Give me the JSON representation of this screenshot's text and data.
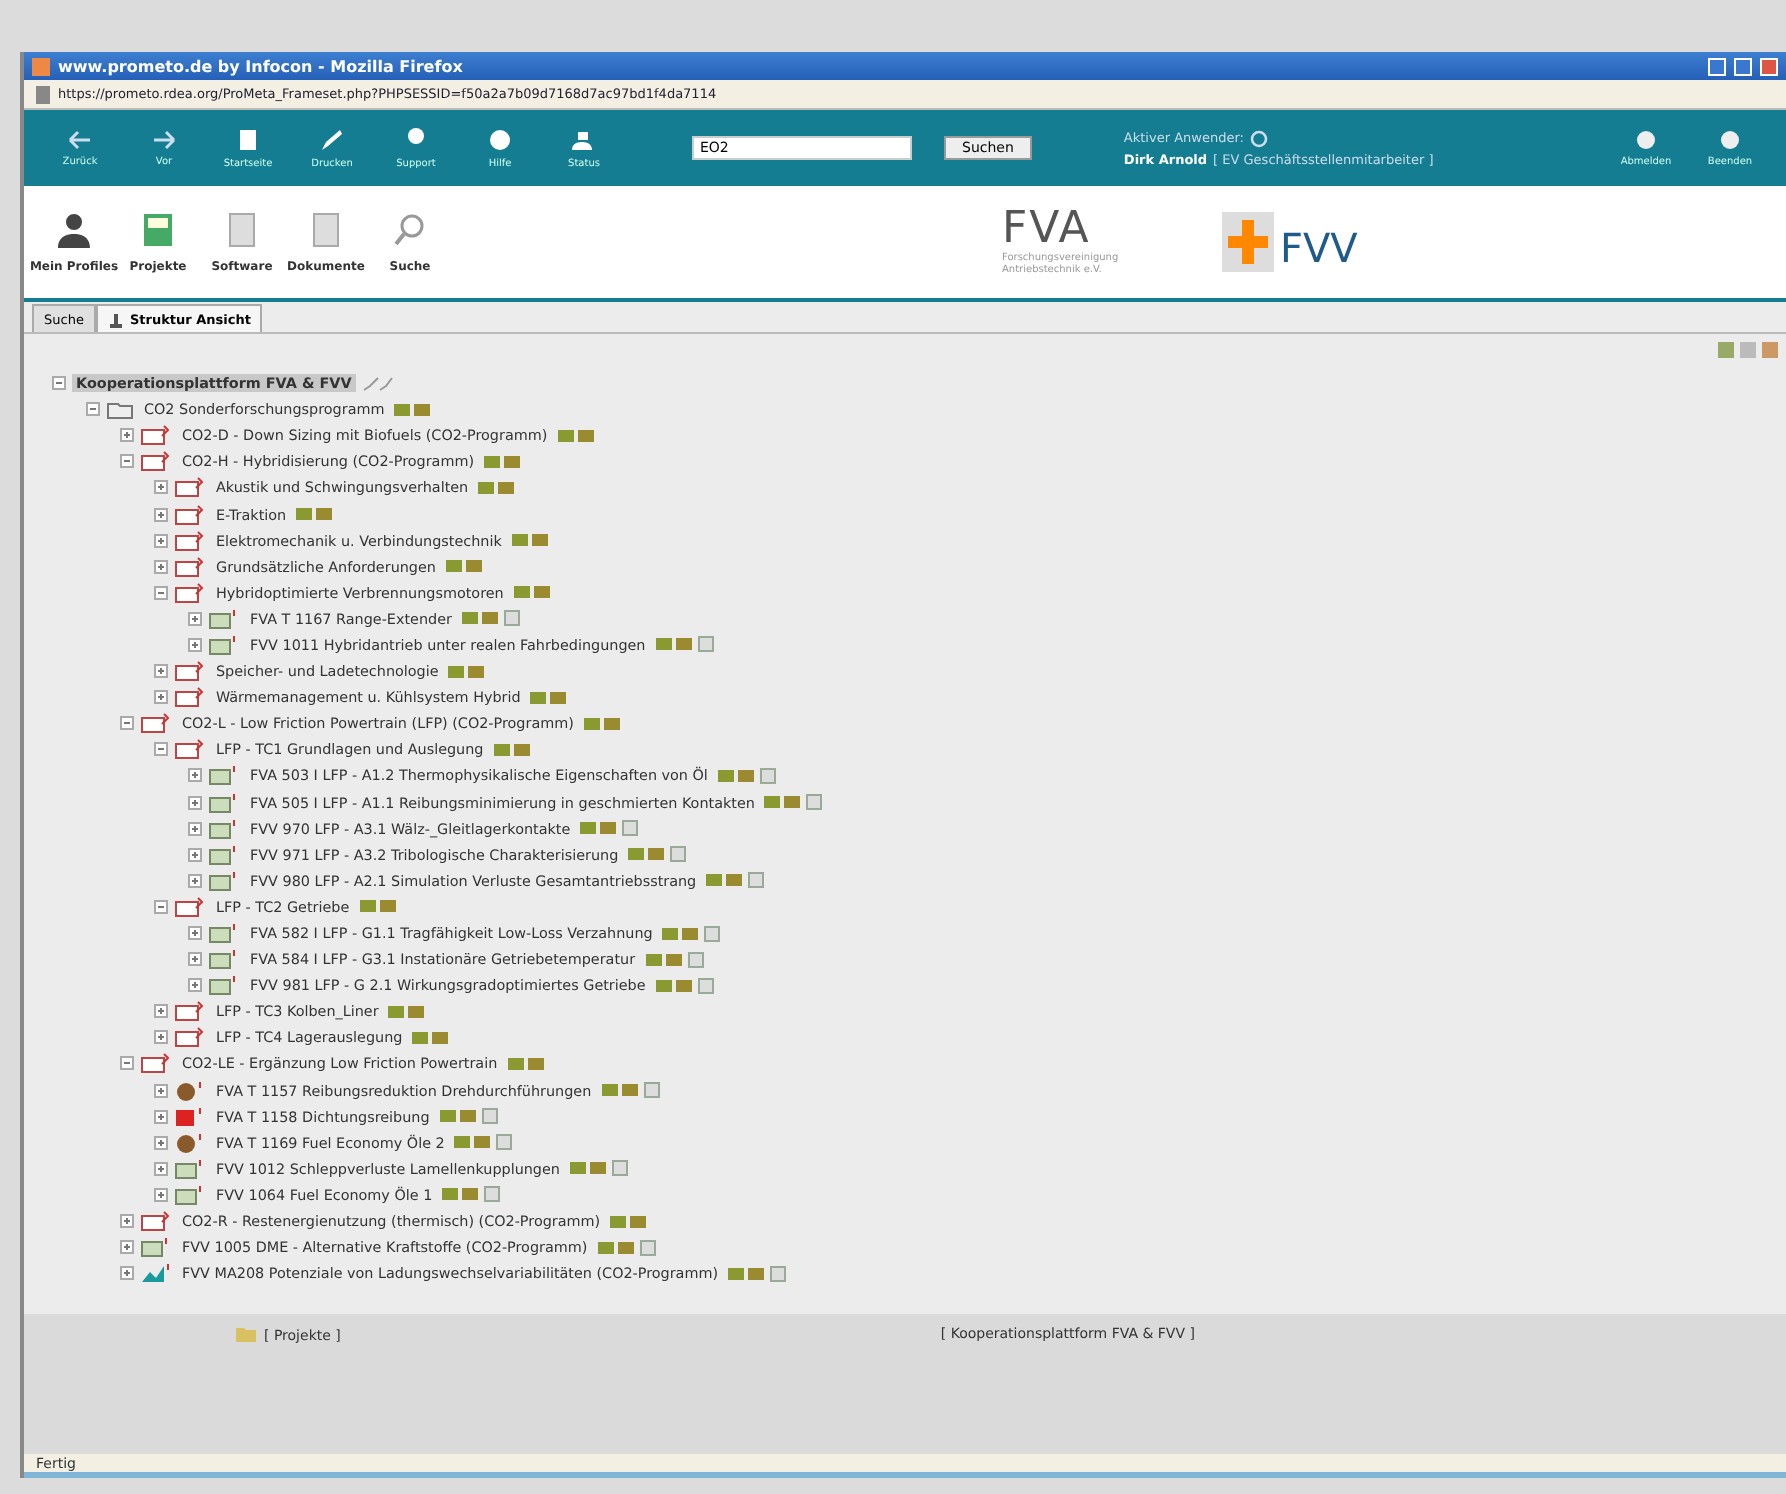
{
  "window": {
    "title": "www.prometo.de by Infocon - Mozilla Firefox",
    "address": "https://prometo.rdea.org/ProMeta_Frameset.php?PHPSESSID=f50a2a7b09d7168d7ac97bd1f4da7114"
  },
  "nav": {
    "buttons": [
      {
        "label": "Zurück"
      },
      {
        "label": "Vor"
      },
      {
        "label": "Startseite"
      },
      {
        "label": "Drucken"
      },
      {
        "label": "Support"
      },
      {
        "label": "Hilfe"
      },
      {
        "label": "Status"
      }
    ],
    "search": {
      "value": "EO2",
      "button": "Suchen"
    },
    "user_label": "Aktiver Anwender:",
    "user": "Dirk Arnold",
    "role": "[ EV Geschäftsstellenmitarbeiter ]",
    "right_buttons": [
      {
        "label": "Abmelden"
      },
      {
        "label": "Beenden"
      }
    ]
  },
  "modules": [
    {
      "label": "Mein Profiles"
    },
    {
      "label": "Projekte"
    },
    {
      "label": "Software"
    },
    {
      "label": "Dokumente"
    },
    {
      "label": "Suche"
    }
  ],
  "logos": {
    "fva": "FVA",
    "fva_sub": "Forschungsvereinigung Antriebstechnik e.V.",
    "fvv": "FVV"
  },
  "tabs": [
    {
      "label": "Suche",
      "selected": false
    },
    {
      "label": "Struktur Ansicht",
      "selected": true
    }
  ],
  "tree": [
    {
      "label": "Kooperationsplattform FVA & FVV",
      "kind": "root",
      "expanded": true,
      "selected": true,
      "children": [
        {
          "label": "CO2 Sonderforschungsprogramm",
          "kind": "folder",
          "expanded": true,
          "selected": false,
          "report": false,
          "children": [
            {
              "label": "CO2-D - Down Sizing mit Biofuels (CO2-Programm)",
              "kind": "program",
              "expanded": false,
              "selected": false,
              "report": false
            },
            {
              "label": "CO2-H - Hybridisierung (CO2-Programm)",
              "kind": "program",
              "expanded": true,
              "selected": false,
              "report": false,
              "children": [
                {
                  "label": "Akustik und Schwingungsverhalten",
                  "kind": "program",
                  "expanded": false,
                  "selected": false,
                  "report": false
                },
                {
                  "label": "E-Traktion",
                  "kind": "program",
                  "expanded": false,
                  "selected": false,
                  "report": false
                },
                {
                  "label": "Elektromechanik u. Verbindungstechnik",
                  "kind": "program",
                  "expanded": false,
                  "selected": false,
                  "report": false
                },
                {
                  "label": "Grundsätzliche Anforderungen",
                  "kind": "program",
                  "expanded": false,
                  "selected": false,
                  "report": false
                },
                {
                  "label": "Hybridoptimierte Verbrennungsmotoren",
                  "kind": "program",
                  "expanded": true,
                  "selected": false,
                  "report": false,
                  "children": [
                    {
                      "label": "FVA T 1167 Range-Extender",
                      "kind": "project",
                      "expanded": false,
                      "selected": false,
                      "report": true
                    },
                    {
                      "label": "FVV 1011 Hybridantrieb unter realen Fahrbedingungen",
                      "kind": "project",
                      "expanded": false,
                      "selected": false,
                      "report": true
                    }
                  ]
                },
                {
                  "label": "Speicher- und Ladetechnologie",
                  "kind": "program",
                  "expanded": false,
                  "selected": false,
                  "report": false
                },
                {
                  "label": "Wärmemanagement u. Kühlsystem Hybrid",
                  "kind": "program",
                  "expanded": false,
                  "selected": false,
                  "report": false
                }
              ]
            },
            {
              "label": "CO2-L - Low Friction Powertrain (LFP) (CO2-Programm)",
              "kind": "program",
              "expanded": true,
              "selected": false,
              "report": false,
              "children": [
                {
                  "label": "LFP - TC1 Grundlagen und Auslegung",
                  "kind": "program",
                  "expanded": true,
                  "selected": false,
                  "report": false,
                  "children": [
                    {
                      "label": "FVA 503 I LFP - A1.2 Thermophysikalische Eigenschaften von Öl",
                      "kind": "project",
                      "expanded": false,
                      "selected": false,
                      "report": true
                    },
                    {
                      "label": "FVA 505 I LFP - A1.1 Reibungsminimierung in geschmierten Kontakten",
                      "kind": "project",
                      "expanded": false,
                      "selected": false,
                      "report": true
                    },
                    {
                      "label": "FVV 970 LFP - A3.1 Wälz-_Gleitlagerkontakte",
                      "kind": "project",
                      "expanded": false,
                      "selected": false,
                      "report": true
                    },
                    {
                      "label": "FVV 971 LFP - A3.2 Tribologische Charakterisierung",
                      "kind": "project",
                      "expanded": false,
                      "selected": false,
                      "report": true
                    },
                    {
                      "label": "FVV 980 LFP - A2.1 Simulation Verluste Gesamtantriebsstrang",
                      "kind": "project",
                      "expanded": false,
                      "selected": false,
                      "report": true
                    }
                  ]
                },
                {
                  "label": "LFP - TC2 Getriebe",
                  "kind": "program",
                  "expanded": true,
                  "selected": false,
                  "report": false,
                  "children": [
                    {
                      "label": "FVA 582 I LFP - G1.1 Tragfähigkeit Low-Loss Verzahnung",
                      "kind": "project",
                      "expanded": false,
                      "selected": false,
                      "report": true
                    },
                    {
                      "label": "FVA 584 I LFP - G3.1 Instationäre Getriebetemperatur",
                      "kind": "project",
                      "expanded": false,
                      "selected": false,
                      "report": true
                    },
                    {
                      "label": "FVV 981 LFP - G 2.1 Wirkungsgradoptimiertes Getriebe",
                      "kind": "project",
                      "expanded": false,
                      "selected": false,
                      "report": true
                    }
                  ]
                },
                {
                  "label": "LFP - TC3 Kolben_Liner",
                  "kind": "program",
                  "expanded": false,
                  "selected": false,
                  "report": false
                },
                {
                  "label": "LFP - TC4 Lagerauslegung",
                  "kind": "program",
                  "expanded": false,
                  "selected": false,
                  "report": false
                }
              ]
            },
            {
              "label": "CO2-LE - Ergänzung Low Friction Powertrain",
              "kind": "program",
              "expanded": true,
              "selected": false,
              "report": false,
              "children": [
                {
                  "label": "FVA T 1157 Reibungsreduktion Drehdurchführungen",
                  "kind": "brown",
                  "expanded": false,
                  "selected": false,
                  "report": true
                },
                {
                  "label": "FVA T 1158 Dichtungsreibung",
                  "kind": "red",
                  "expanded": false,
                  "selected": false,
                  "report": true
                },
                {
                  "label": "FVA T 1169 Fuel Economy Öle 2",
                  "kind": "brown",
                  "expanded": false,
                  "selected": false,
                  "report": true
                },
                {
                  "label": "FVV 1012 Schleppverluste Lamellenkupplungen",
                  "kind": "project",
                  "expanded": false,
                  "selected": false,
                  "report": true
                },
                {
                  "label": "FVV 1064 Fuel Economy Öle 1",
                  "kind": "project",
                  "expanded": false,
                  "selected": false,
                  "report": true
                }
              ]
            },
            {
              "label": "CO2-R - Restenergienutzung (thermisch) (CO2-Programm)",
              "kind": "program",
              "expanded": false,
              "selected": false,
              "report": false
            },
            {
              "label": "FVV 1005 DME - Alternative Kraftstoffe (CO2-Programm)",
              "kind": "project",
              "expanded": false,
              "selected": false,
              "report": true
            },
            {
              "label": "FVV MA208 Potenziale von Ladungswechselvariabilitäten (CO2-Programm)",
              "kind": "teal",
              "expanded": false,
              "selected": false,
              "report": true
            }
          ]
        }
      ]
    }
  ],
  "footer": {
    "left": "[ Projekte ]",
    "right": "[ Kooperationsplattform FVA & FVV ]"
  },
  "status_bar": "Fertig"
}
